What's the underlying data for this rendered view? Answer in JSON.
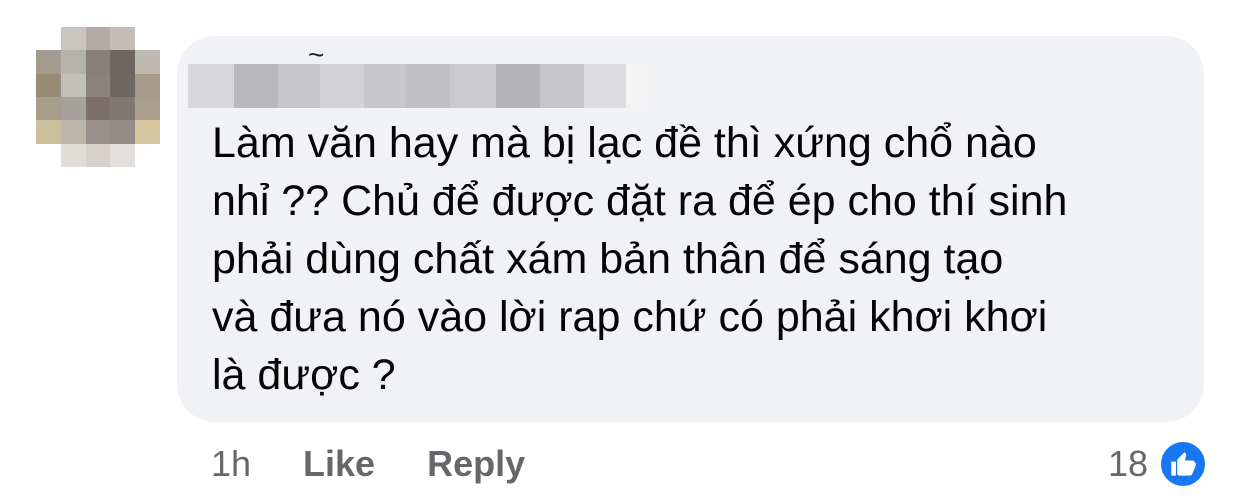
{
  "comment": {
    "author_name": "",
    "text": "Làm văn hay mà bị lạc đề thì xứng chổ nào\nnhỉ ?? Chủ để được đặt ra để ép cho thí sinh\nphải dùng chất xám bản thân để sáng tạo\nvà đưa nó vào lời rap chứ có phải khơi khơi\nlà được ?",
    "time": "1h",
    "like_label": "Like",
    "reply_label": "Reply",
    "reaction_count": "18",
    "reaction_icon": "like-thumb-icon"
  },
  "colors": {
    "bubble_bg": "#f0f2f5",
    "text": "#050505",
    "meta_text": "#65676b",
    "like_blue": "#1877f2"
  }
}
